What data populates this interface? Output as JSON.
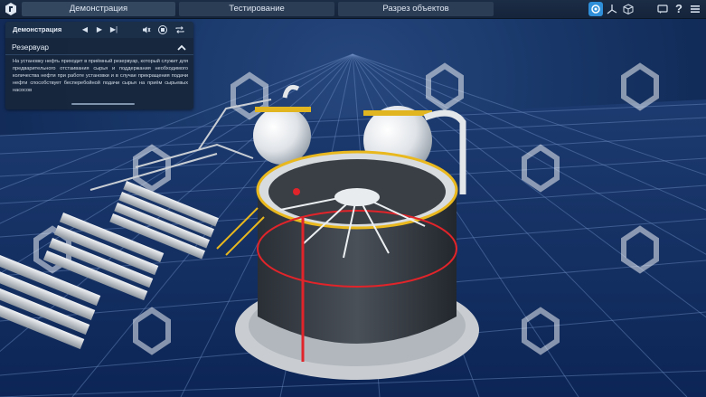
{
  "topbar": {
    "tabs": [
      {
        "label": "Демонстрация",
        "active": true
      },
      {
        "label": "Тестирование",
        "active": false
      },
      {
        "label": "Разрез объектов",
        "active": false
      }
    ],
    "right_icons": [
      "view-mode-icon",
      "axes-icon",
      "cube-icon",
      "chat-icon",
      "help-icon",
      "menu-icon"
    ],
    "help_glyph": "?",
    "selected_icon_color": "#2f8fd8"
  },
  "panel": {
    "title": "Демонстрация",
    "controls": [
      "previous-icon",
      "play-icon",
      "next-icon",
      "sound-icon",
      "record-icon",
      "repeat-icon"
    ],
    "section_title": "Резервуар",
    "text": "На установку нефть приходит в приёмный резервуар, который служит для предварительного отстаивания сырья и поддержания необходимого количества нефти при работе установки и в случае прекращения подачи нефти способствует бесперебойной подачи сырья на приём сырьевых насосов"
  },
  "scene": {
    "description_icons": "watermark-logo-icon",
    "accent_red": "#e0242a",
    "rail_yellow": "#e8b81e"
  }
}
